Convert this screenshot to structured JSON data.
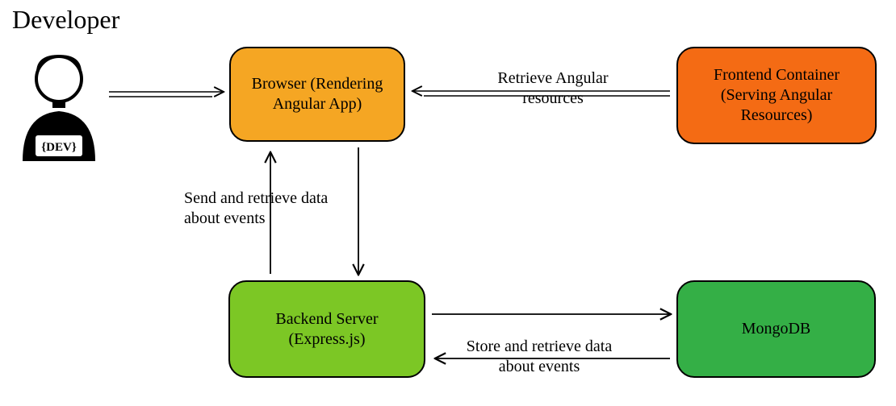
{
  "title": "Developer",
  "nodes": {
    "browser": "Browser (Rendering Angular App)",
    "frontend": "Frontend Container (Serving Angular Resources)",
    "backend": "Backend Server (Express.js)",
    "mongo": "MongoDB"
  },
  "labels": {
    "retrieve_angular": "Retrieve Angular resources",
    "send_retrieve_events": "Send and retrieve data about events",
    "store_retrieve_events": "Store and retrieve data about events"
  },
  "dev_badge": "{DEV}"
}
